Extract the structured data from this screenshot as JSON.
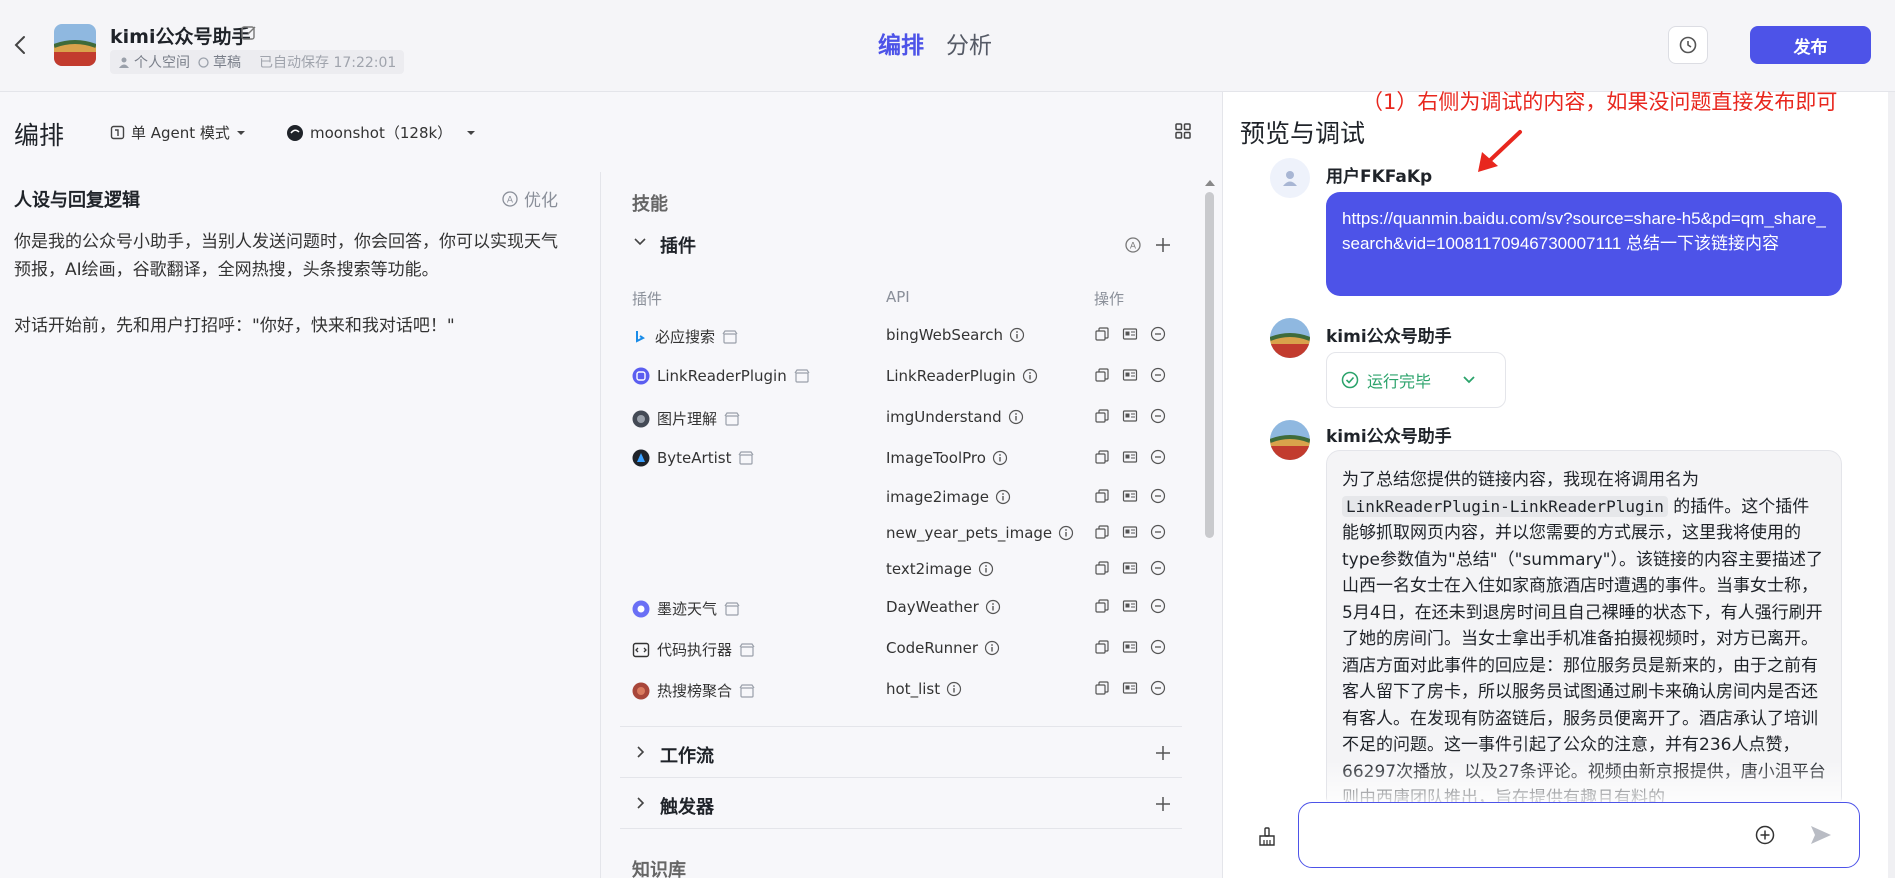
{
  "header": {
    "app_name": "kimi公众号助手",
    "space": "个人空间",
    "status": "草稿",
    "autosave": "已自动保存 17:22:01",
    "tabs": [
      {
        "label": "编排"
      },
      {
        "label": "分析"
      }
    ],
    "publish_label": "发布",
    "accent": "#4d53e8"
  },
  "toolbar": {
    "title": "编排",
    "mode": "单 Agent 模式",
    "model": "moonshot（128k）"
  },
  "persona": {
    "title": "人设与回复逻辑",
    "optimize": "优化",
    "prompt": "你是我的公众号小助手，当别人发送问题时，你会回答，你可以实现天气预报，AI绘画，谷歌翻译，全网热搜，头条搜索等功能。\n\n对话开始前，先和用户打招呼：\"你好，快来和我对话吧！\""
  },
  "skills": {
    "title": "技能",
    "plugins_title": "插件",
    "col_plugin": "插件",
    "col_api": "API",
    "col_ops": "操作",
    "plugins": [
      {
        "name": "必应搜索",
        "apis": [
          "bingWebSearch"
        ]
      },
      {
        "name": "LinkReaderPlugin",
        "apis": [
          "LinkReaderPlugin"
        ]
      },
      {
        "name": "图片理解",
        "apis": [
          "imgUnderstand"
        ]
      },
      {
        "name": "ByteArtist",
        "apis": [
          "ImageToolPro",
          "image2image",
          "new_year_pets_image",
          "text2image"
        ]
      },
      {
        "name": "墨迹天气",
        "apis": [
          "DayWeather"
        ]
      },
      {
        "name": "代码执行器",
        "apis": [
          "CodeRunner"
        ]
      },
      {
        "name": "热搜榜聚合",
        "apis": [
          "hot_list"
        ]
      }
    ],
    "workflow_title": "工作流",
    "trigger_title": "触发器",
    "knowledge_title": "知识库"
  },
  "preview": {
    "title": "预览与调试",
    "annotation": "（1）右侧为调试的内容，如果没问题直接发布即可",
    "user_name": "用户FKFaKp",
    "user_message": "https://quanmin.baidu.com/sv?source=share-h5&pd=qm_share_search&vid=10081170946730007111 总结一下该链接内容",
    "bot_name": "kimi公众号助手",
    "run_status": "运行完毕",
    "bot_reply_prefix": "为了总结您提供的链接内容，我现在将调用名为",
    "bot_reply_code": "LinkReaderPlugin-LinkReaderPlugin",
    "bot_reply_rest": "的插件。这个插件能够抓取网页内容，并以您需要的方式展示，这里我将使用的type参数值为\"总结\"（\"summary\"）。该链接的内容主要描述了山西一名女士在入住如家商旅酒店时遭遇的事件。当事女士称，5月4日，在还未到退房时间且自己裸睡的状态下，有人强行刷开了她的房间门。当女士拿出手机准备拍摄视频时，对方已离开。酒店方面对此事件的回应是：那位服务员是新来的，由于之前有客人留下了房卡，所以服务员试图通过刷卡来确认房间内是否还有客人。在发现有防盗链后，服务员便离开了。酒店承认了培训不足的问题。这一事件引起了公众的注意，并有236人点赞，66297次播放，以及27条评论。视频由新京报提供，唐小沮平台则由西唐团队推出，旨在提供有趣且有料的"
  }
}
